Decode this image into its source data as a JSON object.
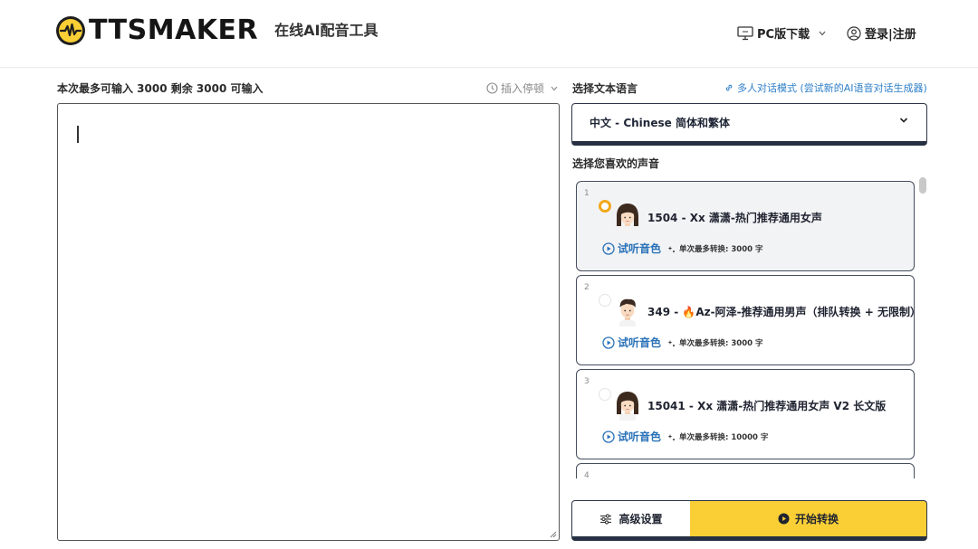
{
  "header": {
    "logo_text": "TTSMAKER",
    "logo_subtitle": "在线AI配音工具",
    "pc_download": "PC版下载",
    "login_register": "登录|注册"
  },
  "editor": {
    "char_limit_text": "本次最多可输入 3000 剩余 3000 可输入",
    "insert_pause": "插入停顿",
    "text_value": ""
  },
  "language": {
    "label": "选择文本语言",
    "multi_dialog_link": "多人对话模式 (尝试新的AI语音对话生成器)",
    "selected": "中文 - Chinese 简体和繁体"
  },
  "voices": {
    "label": "选择您喜欢的声音",
    "items": [
      {
        "num": "1",
        "name": "1504 - Xx 潇潇-热门推荐通用女声",
        "listen": "试听音色",
        "limit": "单次最多转换: 3000 字",
        "selected": true
      },
      {
        "num": "2",
        "name": "349 - 🔥Az-阿泽-推荐通用男声（排队转换 + 无限制）",
        "listen": "试听音色",
        "limit": "单次最多转换: 3000 字",
        "selected": false
      },
      {
        "num": "3",
        "name": "15041 - Xx 潇潇-热门推荐通用女声 V2 长文版",
        "listen": "试听音色",
        "limit": "单次最多转换: 10000 字",
        "selected": false
      },
      {
        "num": "4"
      }
    ]
  },
  "actions": {
    "advanced_settings": "高级设置",
    "start_convert": "开始转换"
  },
  "colors": {
    "accent_yellow": "#f9cf35",
    "selected_radio": "#f2a81c",
    "link_blue": "#2a72b8",
    "border_dark": "#2c3548"
  }
}
